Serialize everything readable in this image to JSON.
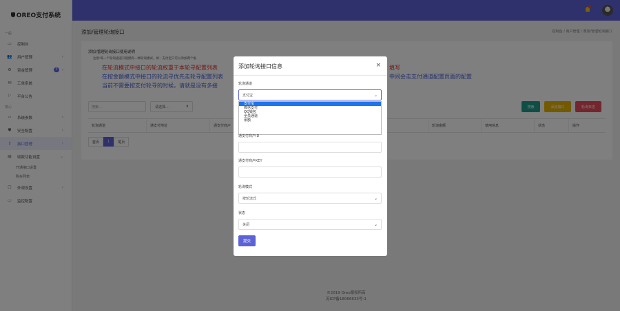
{
  "app": {
    "logo": "OREO支付系统"
  },
  "sidebar": {
    "sections": [
      "一般",
      "核心"
    ],
    "items": [
      {
        "label": "控制台",
        "icon": "monitor-icon"
      },
      {
        "label": "用户管理",
        "icon": "users-icon"
      },
      {
        "label": "资金管理",
        "icon": "funds-icon",
        "badge": "0"
      },
      {
        "label": "工单系统",
        "icon": "ticket-icon"
      },
      {
        "label": "平台公告",
        "icon": "announce-icon"
      },
      {
        "label": "系统参数",
        "icon": "code-icon"
      },
      {
        "label": "安全配置",
        "icon": "shield-icon"
      },
      {
        "label": "接口管理",
        "icon": "key-icon"
      },
      {
        "label": "收款功能设置",
        "icon": "payment-settings-icon"
      },
      {
        "label": "外观设置",
        "icon": "appearance-icon"
      },
      {
        "label": "监控配置",
        "icon": "monitor-config-icon"
      }
    ],
    "subitems": [
      "开通接口设置",
      "购买列表"
    ]
  },
  "header": {
    "title": "添加/管理轮询接口",
    "breadcrumb": "控制台 / 商户管理 / 添加/管理轮询接口"
  },
  "card": {
    "heading": "添加/管理轮询接口使用说明",
    "note_small": "注意:每一个轮询通道只能拥有一种轮询模式。如：支付宝只可以添加两个账",
    "note_red": "在轮流模式中接口的轮流权重于本轮寻配置列表",
    "note_blue": "在按金额模式中接口的轮流寻优先走轮寻配置列表",
    "note_blue2": "当前不需要按支付轮寻的时候，请就是没有多接",
    "note_right_red": "填写",
    "note_right_blue": "中间会走支付通道配置页面的配置",
    "search_placeholder": "搜索...",
    "select_label": "请选择...",
    "btn_search": "搜索",
    "btn_add": "添加接口",
    "btn_log": "轮询日志",
    "columns": [
      "轮询通道",
      "通支付地址",
      "通支付商户",
      "",
      "",
      "",
      "轮询金额",
      "使用信息",
      "状态",
      "操作"
    ],
    "pager": {
      "first": "首页",
      "current": "1",
      "last": "尾页"
    }
  },
  "footer": {
    "line1": "©2019 Oreo版权所有",
    "line2": "苏ICP备18066633号-1"
  },
  "modal": {
    "title": "添加轮询接口信息",
    "close": "×",
    "channel_label": "轮询通道",
    "channel_value": "支付宝",
    "channel_options": [
      "支付宝",
      "微信支付",
      "QQ钱包",
      "全员通道",
      "余额"
    ],
    "merchant_id_label": "通支付商户ID",
    "merchant_key_label": "通支付商户KEY",
    "mode_label": "轮询模式",
    "mode_value": "按轮流式",
    "status_label": "状态",
    "status_value": "关闭",
    "submit": "提交"
  }
}
